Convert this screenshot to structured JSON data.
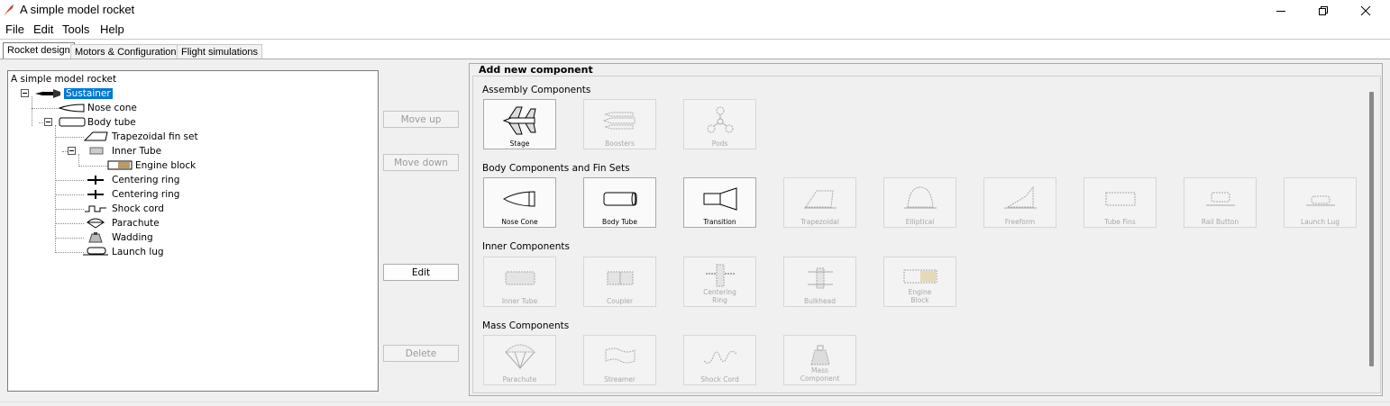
{
  "window": {
    "title": "A simple model rocket",
    "icon": "rocket-icon"
  },
  "menu": [
    "File",
    "Edit",
    "Tools",
    "Help"
  ],
  "tabs": [
    "Rocket design",
    "Motors & Configuration",
    "Flight simulations"
  ],
  "tree": {
    "root": "A simple model rocket",
    "nodes": [
      {
        "label": "Sustainer",
        "icon": "stage-icon"
      },
      {
        "label": "Nose cone",
        "icon": "nose-cone-icon"
      },
      {
        "label": "Body tube",
        "icon": "body-tube-icon"
      },
      {
        "label": "Trapezoidal fin set",
        "icon": "trapezoidal-fin-icon"
      },
      {
        "label": "Inner Tube",
        "icon": "inner-tube-icon"
      },
      {
        "label": "Engine block",
        "icon": "engine-block-icon"
      },
      {
        "label": "Centering ring",
        "icon": "centering-ring-icon"
      },
      {
        "label": "Centering ring",
        "icon": "centering-ring-icon"
      },
      {
        "label": "Shock cord",
        "icon": "shock-cord-icon"
      },
      {
        "label": "Parachute",
        "icon": "parachute-icon"
      },
      {
        "label": "Wadding",
        "icon": "wadding-icon"
      },
      {
        "label": "Launch lug",
        "icon": "launch-lug-icon"
      }
    ]
  },
  "buttons": {
    "move_up": "Move up",
    "move_down": "Move down",
    "edit": "Edit",
    "delete": "Delete"
  },
  "add_panel": {
    "title": "Add new component",
    "sections": [
      {
        "title": "Assembly Components",
        "items": [
          {
            "label": [
              "Stage"
            ],
            "enabled": true,
            "icon": "stage-icon"
          },
          {
            "label": [
              "Boosters"
            ],
            "enabled": false,
            "icon": "boosters-icon"
          },
          {
            "label": [
              "Pods"
            ],
            "enabled": false,
            "icon": "pods-icon"
          }
        ]
      },
      {
        "title": "Body Components and Fin Sets",
        "items": [
          {
            "label": [
              "Nose Cone"
            ],
            "enabled": true,
            "icon": "nose-cone-icon"
          },
          {
            "label": [
              "Body Tube"
            ],
            "enabled": true,
            "icon": "body-tube-icon"
          },
          {
            "label": [
              "Transition"
            ],
            "enabled": true,
            "icon": "transition-icon"
          },
          {
            "label": [
              "Trapezoidal"
            ],
            "enabled": false,
            "icon": "trapezoidal-fin-icon"
          },
          {
            "label": [
              "Elliptical"
            ],
            "enabled": false,
            "icon": "elliptical-fin-icon"
          },
          {
            "label": [
              "Freeform"
            ],
            "enabled": false,
            "icon": "freeform-fin-icon"
          },
          {
            "label": [
              "Tube Fins"
            ],
            "enabled": false,
            "icon": "tube-fins-icon"
          },
          {
            "label": [
              "Rail Button"
            ],
            "enabled": false,
            "icon": "rail-button-icon"
          },
          {
            "label": [
              "Launch Lug"
            ],
            "enabled": false,
            "icon": "launch-lug-icon"
          }
        ]
      },
      {
        "title": "Inner Components",
        "items": [
          {
            "label": [
              "Inner Tube"
            ],
            "enabled": false,
            "icon": "inner-tube-icon"
          },
          {
            "label": [
              "Coupler"
            ],
            "enabled": false,
            "icon": "coupler-icon"
          },
          {
            "label": [
              "Centering",
              "Ring"
            ],
            "enabled": false,
            "icon": "centering-ring-icon"
          },
          {
            "label": [
              "Bulkhead"
            ],
            "enabled": false,
            "icon": "bulkhead-icon"
          },
          {
            "label": [
              "Engine",
              "Block"
            ],
            "enabled": false,
            "icon": "engine-block-icon"
          }
        ]
      },
      {
        "title": "Mass Components",
        "items": [
          {
            "label": [
              "Parachute"
            ],
            "enabled": false,
            "icon": "parachute-icon"
          },
          {
            "label": [
              "Streamer"
            ],
            "enabled": false,
            "icon": "streamer-icon"
          },
          {
            "label": [
              "Shock Cord"
            ],
            "enabled": false,
            "icon": "shock-cord-icon"
          },
          {
            "label": [
              "Mass",
              "Component"
            ],
            "enabled": false,
            "icon": "mass-component-icon"
          }
        ]
      }
    ]
  }
}
